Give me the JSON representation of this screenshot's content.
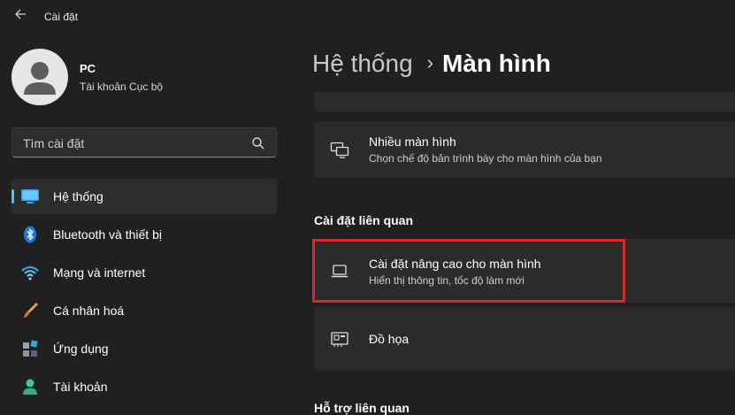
{
  "window": {
    "title": "Cài đặt"
  },
  "profile": {
    "name": "PC",
    "account_type": "Tài khoản Cục bộ"
  },
  "search": {
    "placeholder": "Tìm cài đặt"
  },
  "sidebar": {
    "items": [
      {
        "label": "Hệ thống",
        "icon": "monitor-icon",
        "active": true
      },
      {
        "label": "Bluetooth và thiết bị",
        "icon": "bluetooth-icon"
      },
      {
        "label": "Mạng và internet",
        "icon": "wifi-icon"
      },
      {
        "label": "Cá nhân hoá",
        "icon": "paintbrush-icon"
      },
      {
        "label": "Ứng dụng",
        "icon": "apps-icon"
      },
      {
        "label": "Tài khoản",
        "icon": "person-icon"
      }
    ]
  },
  "breadcrumb": {
    "parent": "Hệ thống",
    "separator": "›",
    "current": "Màn hình"
  },
  "main": {
    "multiple_displays": {
      "title": "Nhiều màn hình",
      "description": "Chọn chế độ bản trình bày cho màn hình của bạn"
    },
    "related_section": {
      "heading": "Cài đặt liên quan"
    },
    "advanced_display": {
      "title": "Cài đặt nâng cao cho màn hình",
      "description": "Hiển thị thông tin, tốc độ làm mới"
    },
    "graphics": {
      "title": "Đồ họa"
    },
    "next_section_heading": "Hỗ trợ liên quan"
  },
  "colors": {
    "accent": "#4cc2ff",
    "highlight": "#d42a2a",
    "background": "#202020",
    "card": "#2b2b2b"
  }
}
